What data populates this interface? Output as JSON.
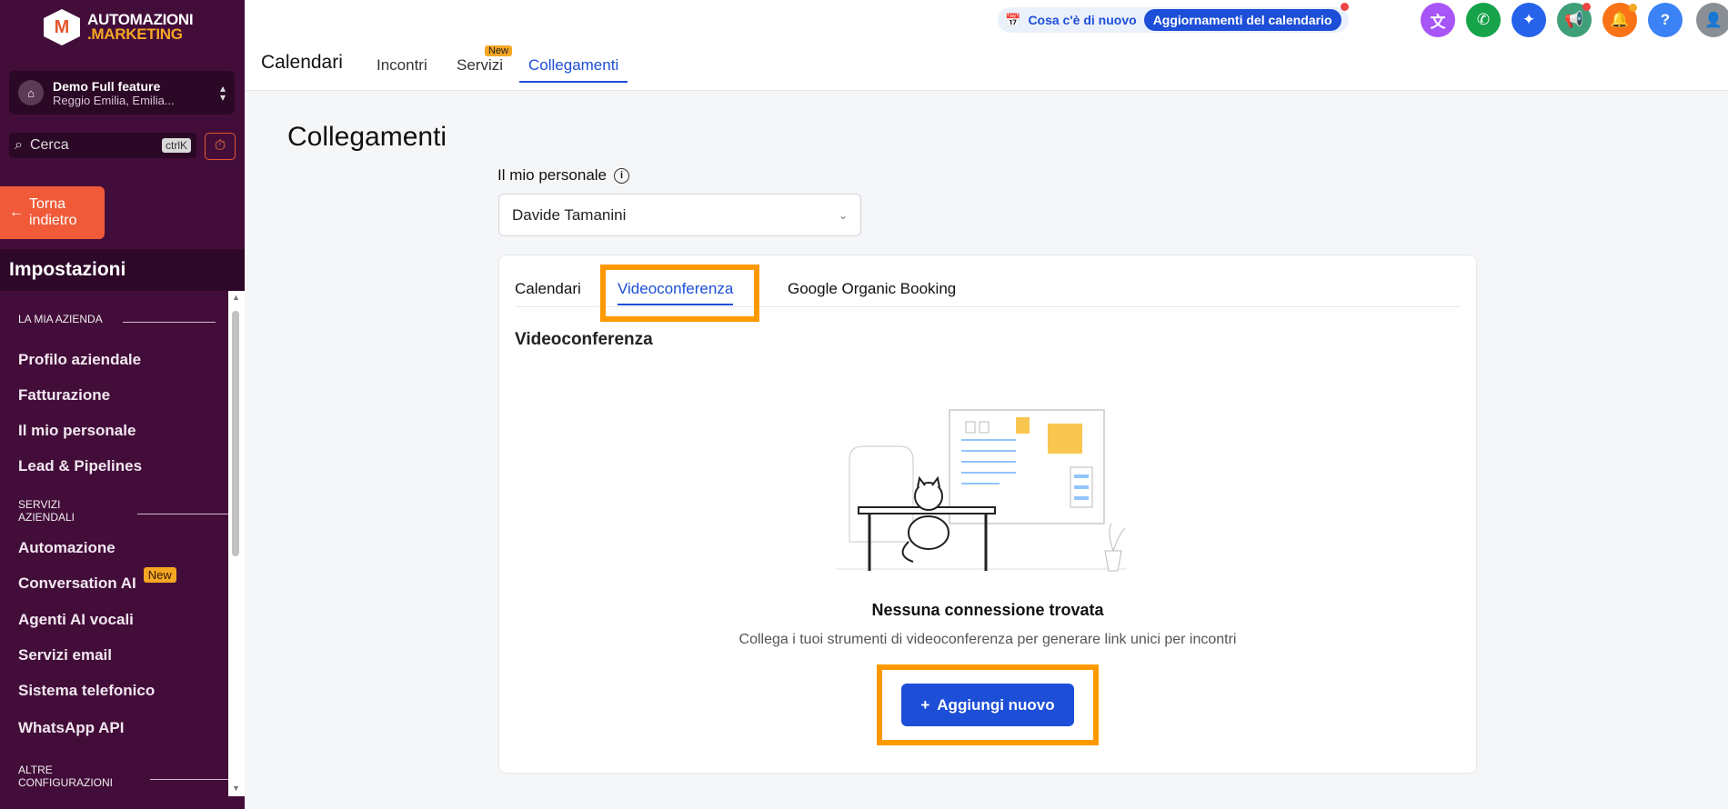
{
  "brand": {
    "line1": "AUTOMAZIONI",
    "line2": ".MARKETING"
  },
  "account": {
    "name": "Demo Full feature",
    "location": "Reggio Emilia, Emilia..."
  },
  "search": {
    "placeholder": "Cerca",
    "shortcut": "ctrlK"
  },
  "back_button": {
    "line1": "Torna",
    "line2": "indietro"
  },
  "settings_title": "Impostazioni",
  "sidebar": {
    "groups": [
      {
        "header": "LA MIA AZIENDA"
      },
      {
        "header": "SERVIZI AZIENDALI"
      },
      {
        "header": "ALTRE CONFIGURAZIONI"
      }
    ],
    "items": [
      {
        "label": "Profilo aziendale"
      },
      {
        "label": "Fatturazione"
      },
      {
        "label": "Il mio personale"
      },
      {
        "label": "Lead & Pipelines"
      },
      {
        "label": "Automazione"
      },
      {
        "label": "Conversation AI",
        "badge": "New"
      },
      {
        "label": "Agenti AI vocali"
      },
      {
        "label": "Servizi email"
      },
      {
        "label": "Sistema telefonico"
      },
      {
        "label": "WhatsApp API"
      }
    ]
  },
  "topbar": {
    "whats_new": "Cosa c'è di nuovo",
    "update_pill": "Aggiornamenti del calendario",
    "icons": [
      {
        "name": "translate-icon",
        "color": "#a855f7"
      },
      {
        "name": "phone-icon",
        "color": "#16a34a"
      },
      {
        "name": "sparkle-icon",
        "color": "#2563eb"
      },
      {
        "name": "megaphone-icon",
        "color": "#3f9f78"
      },
      {
        "name": "bell-icon",
        "color": "#f97316"
      },
      {
        "name": "help-icon",
        "color": "#3b82f6"
      }
    ]
  },
  "header": {
    "title": "Calendari",
    "tabs": [
      {
        "label": "Incontri"
      },
      {
        "label": "Servizi",
        "badge": "New"
      },
      {
        "label": "Collegamenti",
        "active": true
      }
    ]
  },
  "main": {
    "page_title": "Collegamenti",
    "staff_label": "Il mio personale",
    "staff_value": "Davide Tamanini",
    "tabs": [
      {
        "label": "Calendari"
      },
      {
        "label": "Videoconferenza",
        "active": true
      },
      {
        "label": "Google Organic Booking"
      }
    ],
    "section_title": "Videoconferenza",
    "empty_title": "Nessuna connessione trovata",
    "empty_subtitle": "Collega i tuoi strumenti di videoconferenza per generare link unici per incontri",
    "add_button": "Aggiungi nuovo"
  },
  "colors": {
    "sidebar": "#430d3a",
    "accent": "#1d4ed8",
    "highlight": "#ff9900",
    "back_button": "#f05a38"
  }
}
